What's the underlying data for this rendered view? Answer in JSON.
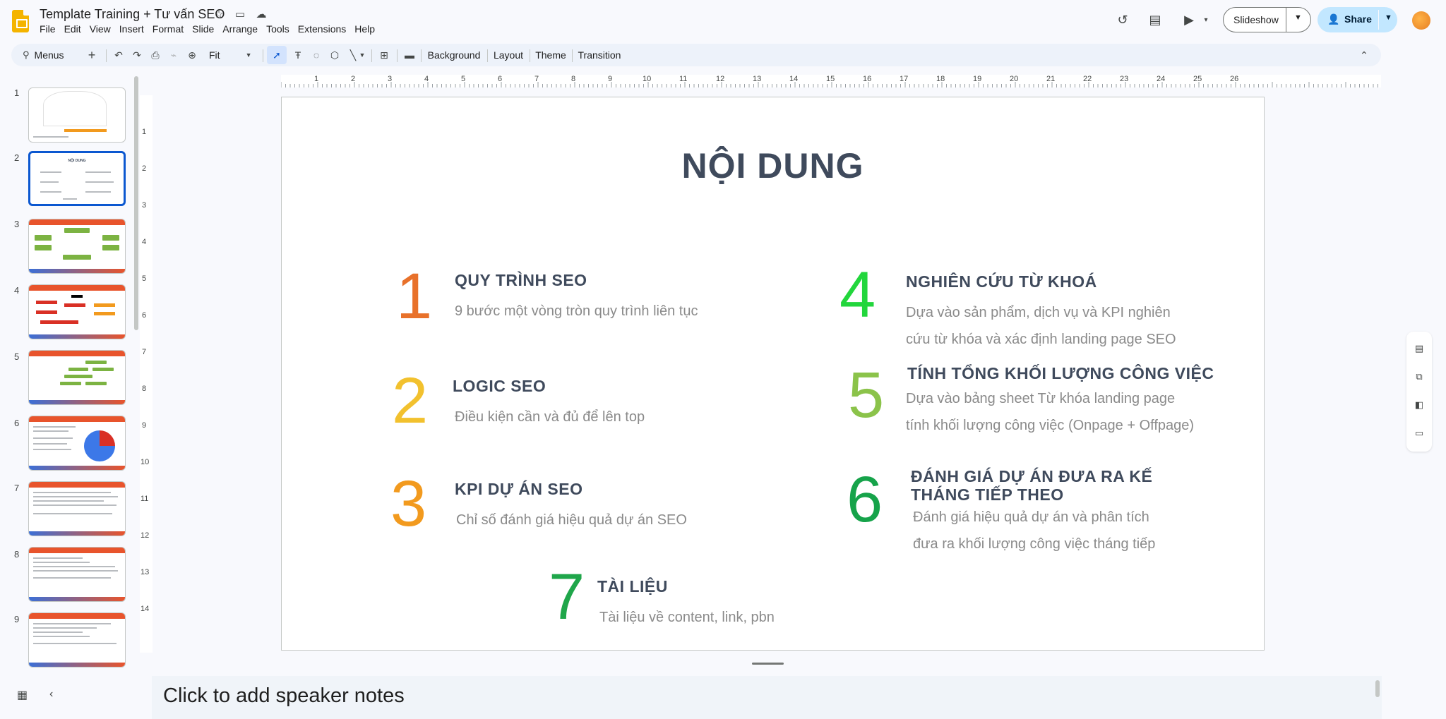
{
  "header": {
    "title": "Template Training + Tư vấn SEO",
    "menu": [
      "File",
      "Edit",
      "View",
      "Insert",
      "Format",
      "Slide",
      "Arrange",
      "Tools",
      "Extensions",
      "Help"
    ],
    "slideshow_label": "Slideshow",
    "share_label": "Share"
  },
  "toolbar": {
    "search_label": "Menus",
    "zoom_label": "Fit",
    "background_label": "Background",
    "layout_label": "Layout",
    "theme_label": "Theme",
    "transition_label": "Transition"
  },
  "ruler": {
    "h": [
      "1",
      "2",
      "3",
      "4",
      "5",
      "6",
      "7",
      "8",
      "9",
      "10",
      "11",
      "12",
      "13",
      "14",
      "15",
      "16",
      "17",
      "18",
      "19",
      "20",
      "21",
      "22",
      "23",
      "24",
      "25",
      "26"
    ],
    "v": [
      "1",
      "2",
      "3",
      "4",
      "5",
      "6",
      "7",
      "8",
      "9",
      "10",
      "11",
      "12",
      "13",
      "14"
    ]
  },
  "filmstrip": {
    "numbers": [
      "1",
      "2",
      "3",
      "4",
      "5",
      "6",
      "7",
      "8",
      "9"
    ],
    "selected": "2"
  },
  "slide": {
    "title": "NỘI DUNG",
    "items": [
      {
        "num": "1",
        "color": "#e8712a",
        "head": "QUY TRÌNH SEO",
        "desc": [
          "9 bước một vòng tròn quy trình liên tục"
        ]
      },
      {
        "num": "2",
        "color": "#f2c12e",
        "head": "LOGIC SEO",
        "desc": [
          "Điều kiện cần và đủ để lên top"
        ]
      },
      {
        "num": "3",
        "color": "#f29a1e",
        "head": "KPI DỰ ÁN SEO",
        "desc": [
          "Chỉ số đánh giá hiệu quả dự án SEO"
        ]
      },
      {
        "num": "4",
        "color": "#22d63c",
        "head": "NGHIÊN CỨU TỪ KHOÁ",
        "desc": [
          "Dựa vào sản phẩm, dịch vụ và KPI nghiên",
          "cứu từ khóa và xác định landing page SEO"
        ]
      },
      {
        "num": "5",
        "color": "#8bc34a",
        "head": "TÍNH TỔNG KHỐI LƯỢNG CÔNG VIỆC",
        "desc": [
          "Dựa vào bảng sheet Từ khóa landing page",
          "tính khối lượng công việc (Onpage + Offpage)"
        ]
      },
      {
        "num": "6",
        "color": "#16a34a",
        "head": "ĐÁNH GIÁ DỰ ÁN ĐƯA RA KẾ",
        "head2": "THÁNG TIẾP THEO",
        "desc": [
          "Đánh giá hiệu quả dự án và phân tích",
          "đưa ra khối lượng công việc tháng tiếp"
        ]
      },
      {
        "num": "7",
        "color": "#1fa64a",
        "head": "TÀI LIỆU",
        "desc": [
          "Tài liệu về content, link, pbn"
        ]
      }
    ]
  },
  "notes": {
    "placeholder": "Click to add speaker notes"
  },
  "colors": {
    "accent": "#0b57d0",
    "share_bg": "#c2e7ff",
    "toolbar_bg": "#edf2fa"
  }
}
